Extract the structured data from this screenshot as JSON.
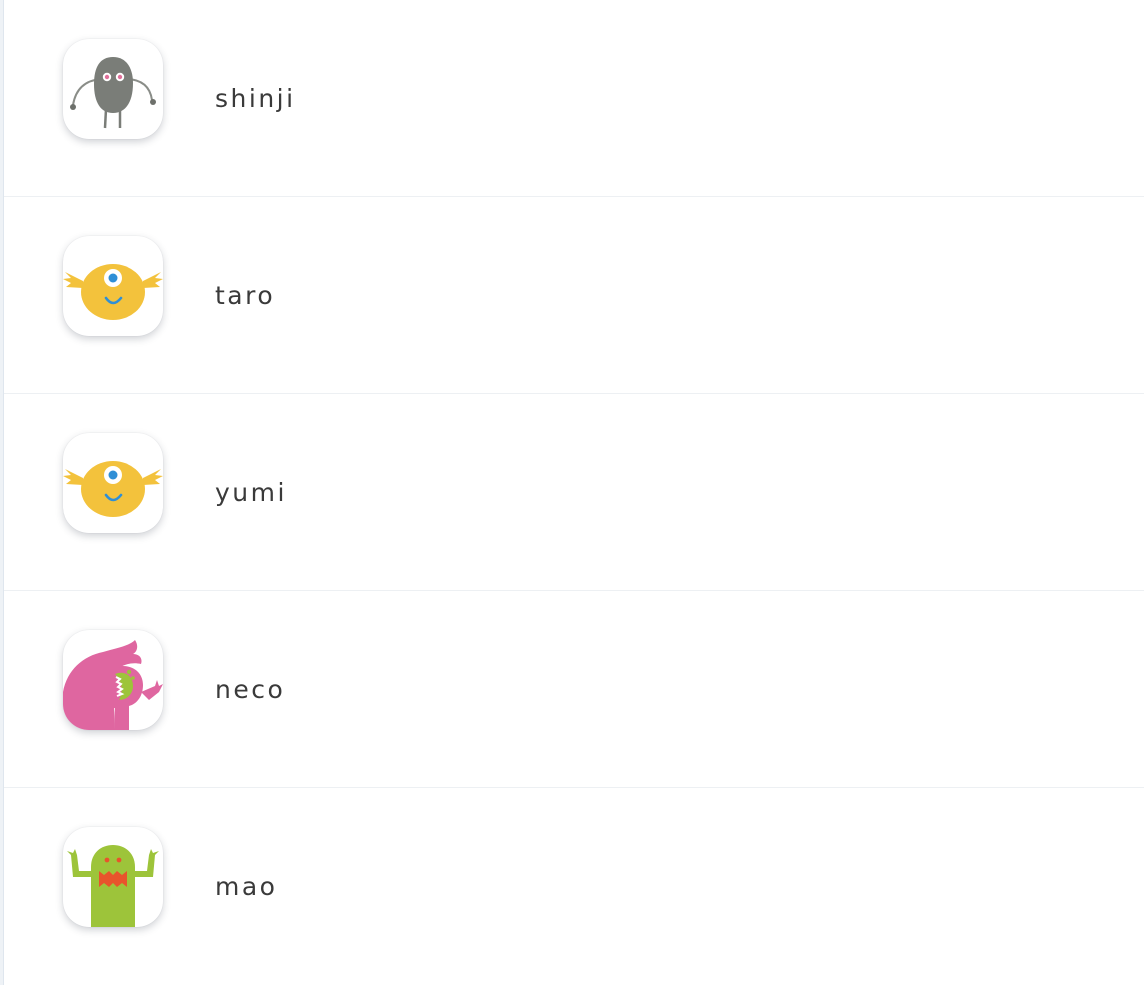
{
  "users": [
    {
      "name": "shinji",
      "avatar_icon": "gray-monster-icon",
      "color": "#7a7d78"
    },
    {
      "name": "taro",
      "avatar_icon": "yellow-cyclops-monster-icon",
      "color": "#f3c23c"
    },
    {
      "name": "yumi",
      "avatar_icon": "yellow-cyclops-monster-icon",
      "color": "#f3c23c"
    },
    {
      "name": "neco",
      "avatar_icon": "pink-monster-icon",
      "color": "#df66a0"
    },
    {
      "name": "mao",
      "avatar_icon": "green-monster-icon",
      "color": "#9dc43a"
    }
  ]
}
